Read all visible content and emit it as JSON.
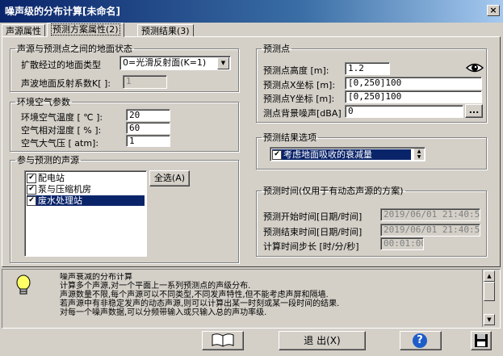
{
  "window": {
    "title": "噪声级的分布计算[未命名]",
    "close": "×"
  },
  "tabs": [
    {
      "label": "声源属性"
    },
    {
      "label": "预测方案属性(2)"
    },
    {
      "label": "预测结果(3)"
    }
  ],
  "ground": {
    "legend": "声源与预测点之间的地面状态",
    "type_label": "扩散经过的地面类型",
    "type_value": "0=光滑反射面(K=1)",
    "coef_label": "声波地面反射系数K[ ]:",
    "coef_value": "1"
  },
  "air": {
    "legend": "环境空气参数",
    "temp_label": "环境空气温度  [ ℃ ]:",
    "temp_value": "20",
    "humidity_label": "空气相对湿度  [  % ]:",
    "humidity_value": "60",
    "pressure_label": "空气大气压    [ atm]:",
    "pressure_value": "1"
  },
  "sources": {
    "legend": "参与预测的声源",
    "select_all": "全选(A)",
    "items": [
      {
        "label": "配电站",
        "checked": "✔"
      },
      {
        "label": "泵与压缩机房",
        "checked": "✔"
      },
      {
        "label": "废水处理站",
        "checked": "✔"
      }
    ]
  },
  "point": {
    "legend": "预测点",
    "height_label": "预测点高度  [m]:",
    "height_value": "1.2",
    "x_label": "预测点X坐标 [m]:",
    "x_value": "[0,250]100",
    "y_label": "预测点Y坐标 [m]:",
    "y_value": "[0,250]100",
    "bg_label": "测点背景噪声[dBA]",
    "bg_value": "0",
    "bg_button": "..."
  },
  "options": {
    "legend": "预测结果选项",
    "item": "考虑地面吸收的衰减量",
    "checked": "✔"
  },
  "time": {
    "legend": "预测时间(仅用于有动态声源的方案)",
    "start_label": "预测开始时间[日期/时间]",
    "start_value": "2019/06/01 21:40:55",
    "end_label": "预测结束时间[日期/时间]",
    "end_value": "2019/06/01 21:40:55",
    "step_label": "计算时间步长 [时/分/秒]",
    "step_value": "00:01:00"
  },
  "info": {
    "lines": [
      "噪声衰减的分布计算",
      "计算多个声源,对一个平面上一系列预测点的声级分布.",
      "声源数量不限,每个声源可以不同类型,不同发声特性,但不能考虑声屏和隔墙.",
      "若声源中有非稳定发声的动态声源,则可以计算出某一时刻或某一段时间的结果.",
      "对每一个噪声数据,可以分频带输入或只输入总的声功率级."
    ]
  },
  "buttons": {
    "exit": "退 出(X)",
    "help": "?"
  }
}
